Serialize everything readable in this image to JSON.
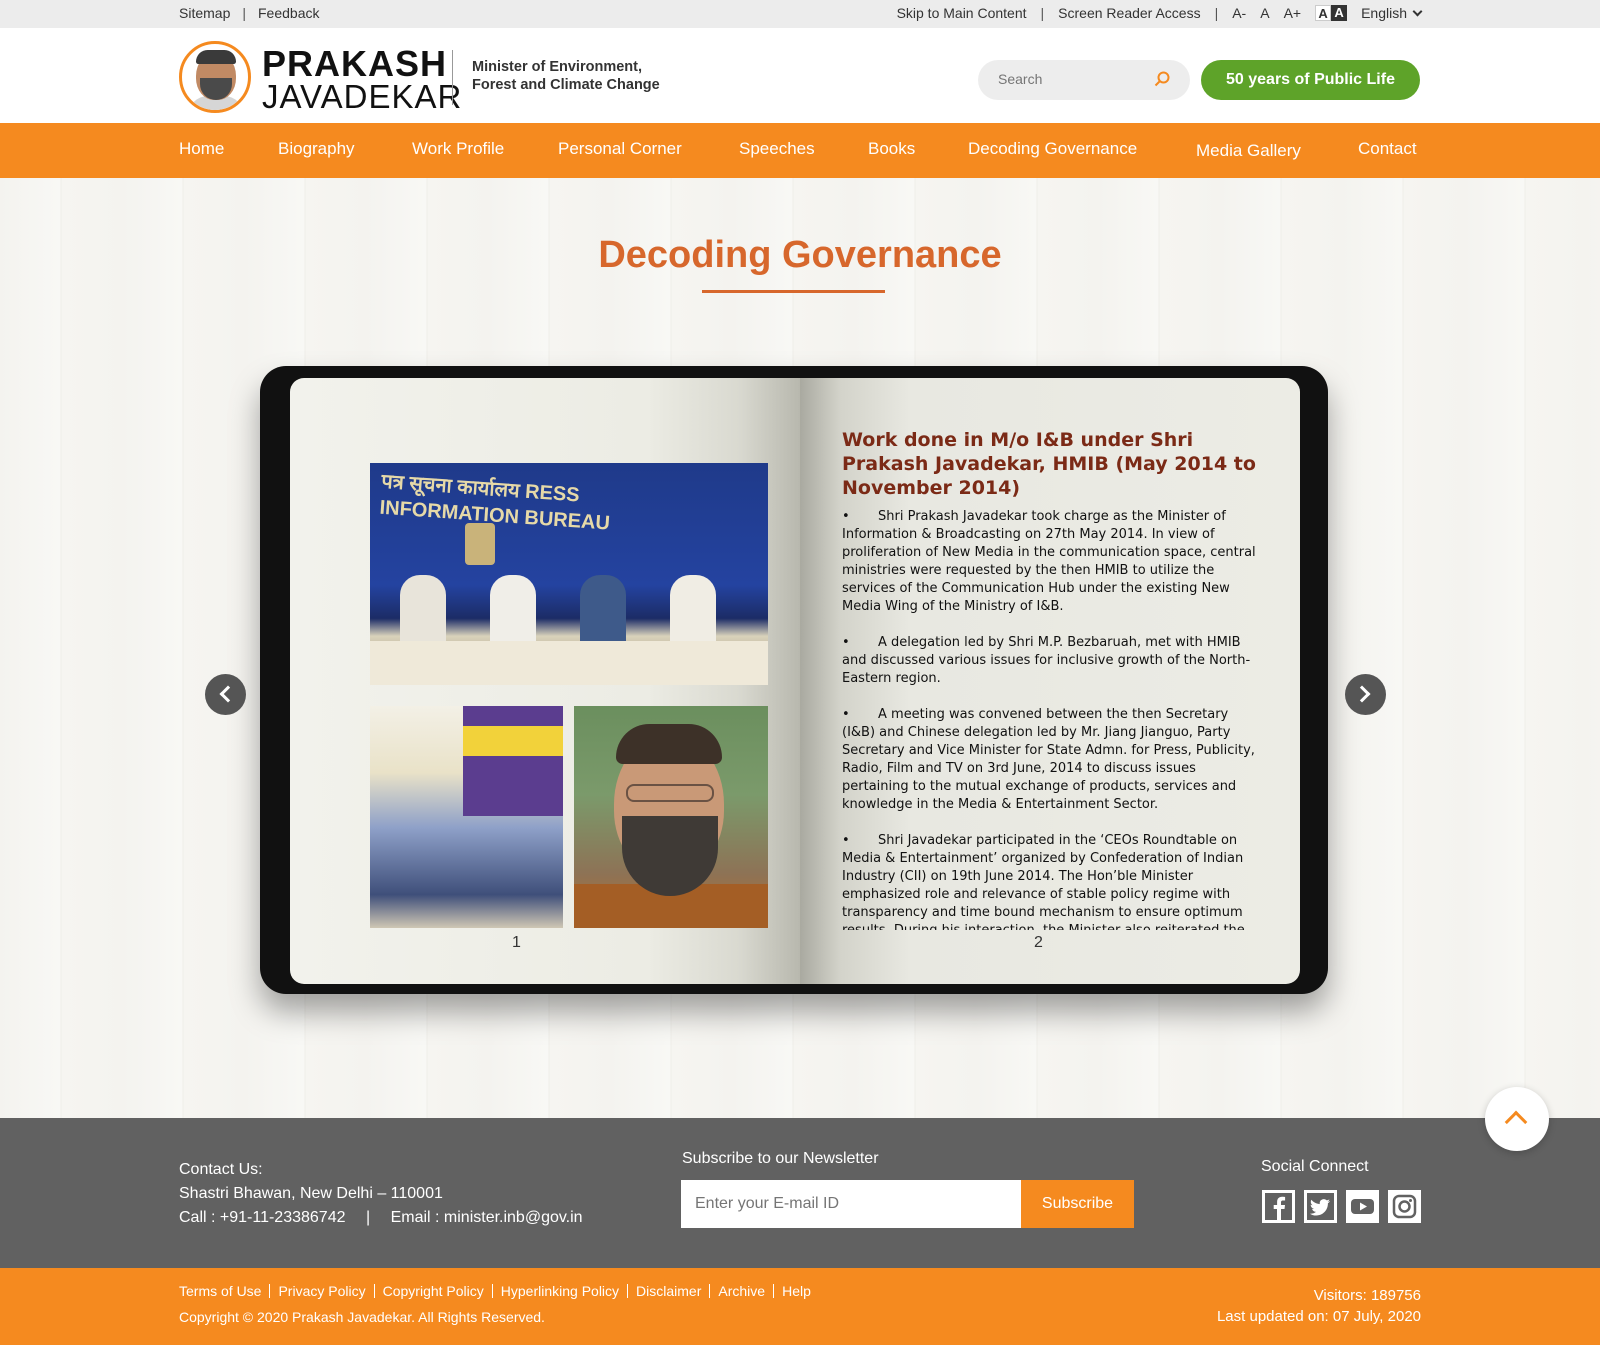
{
  "topbar": {
    "sitemap": "Sitemap",
    "feedback": "Feedback",
    "skip": "Skip to Main Content",
    "screen_reader": "Screen Reader Access",
    "font_decrease": "A-",
    "font_normal": "A",
    "font_increase": "A+",
    "contrast_light": "A",
    "contrast_dark": "A",
    "language": "English"
  },
  "header": {
    "brand_line1": "PRAKASH",
    "brand_line2": "JAVADEKAR",
    "ministry_line1": "Minister of Environment,",
    "ministry_line2": "Forest and Climate Change",
    "search_placeholder": "Search",
    "fifty_years": "50 years of Public Life"
  },
  "nav": {
    "items": [
      "Home",
      "Biography",
      "Work Profile",
      "Personal Corner",
      "Speeches",
      "Books",
      "Decoding Governance",
      "Media Gallery",
      "Contact"
    ]
  },
  "main": {
    "title": "Decoding Governance",
    "photo_banner": "पत्र सूचना कार्यालय RESS INFORMATION BUREAU",
    "page_left_number": "1",
    "page_right_number": "2",
    "article_title": "Work done in M/o I&B under Shri Prakash Javadekar, HMIB (May 2014 to November 2014)",
    "bullets": [
      "Shri Prakash Javadekar took charge as the Minister of Information & Broadcasting on 27th May 2014. In view of proliferation of New Media in the communication space, central ministries were requested by the then HMIB to utilize the services of the Communication Hub under the existing New Media Wing of  the Ministry of I&B.",
      "A delegation led by Shri M.P. Bezbaruah, met with HMIB and discussed various issues for inclusive growth of the North-Eastern region.",
      "A meeting was convened between the then Secretary (I&B) and Chinese delegation led by Mr. Jiang Jianguo, Party Secretary and Vice Minister for State Admn. for Press, Publicity, Radio, Film and TV  on 3rd June, 2014 to discuss issues pertaining to the mutual exchange of products, services and knowledge in the Media & Entertainment Sector.",
      "Shri Javadekar participated in the ‘CEOs Roundtable on Media & Entertainment’ organized by Confederation of Indian Industry (CII) on 19th June 2014. The Hon’ble Minister emphasized role and relevance of stable policy regime with transparency and time bound mechanism to ensure optimum results. During his interaction, the Minister also reiterated the"
    ],
    "bullet_char": "•"
  },
  "footer": {
    "contact_label": "Contact Us:",
    "address": "Shastri Bhawan, New Delhi – 110001",
    "phone": "Call : +91-11-23386742",
    "email": "Email : minister.inb@gov.in",
    "newsletter_label": "Subscribe to our Newsletter",
    "email_placeholder": "Enter your E-mail ID",
    "subscribe": "Subscribe",
    "social_label": "Social Connect",
    "social_icons": [
      "facebook-icon",
      "twitter-icon",
      "youtube-icon",
      "instagram-icon"
    ]
  },
  "bottom": {
    "links": [
      "Terms of Use",
      "Privacy Policy",
      "Copyright Policy",
      "Hyperlinking Policy",
      "Disclaimer",
      "Archive",
      "Help"
    ],
    "copyright": "Copyright © 2020 Prakash Javadekar. All Rights Reserved.",
    "visitors": "Visitors: 189756",
    "last_updated": "Last updated on: 07 July, 2020"
  },
  "colors": {
    "accent_orange": "#f58a1f",
    "title_orange": "#d7672c",
    "green_button": "#5ea329",
    "article_title": "#7b2a16",
    "footer_gray": "#616161"
  }
}
